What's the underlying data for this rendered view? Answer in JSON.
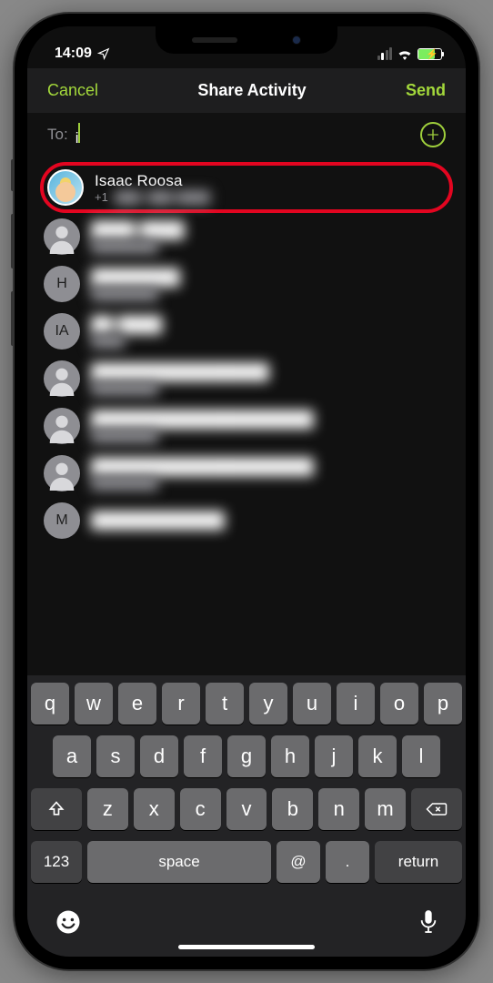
{
  "status": {
    "time": "14:09",
    "location_glyph": "✈"
  },
  "nav": {
    "cancel": "Cancel",
    "title": "Share Activity",
    "send": "Send"
  },
  "to": {
    "label": "To:",
    "value": "i"
  },
  "contacts": [
    {
      "name": "Isaac Roosa",
      "sub": "+1",
      "highlighted": true,
      "avatar_type": "memoji",
      "initial": ""
    },
    {
      "name": "████ ████",
      "sub": "████████",
      "avatar_type": "person",
      "initial": ""
    },
    {
      "name": "████████",
      "sub": "████████",
      "avatar_type": "initial",
      "initial": "H"
    },
    {
      "name": "██ ████",
      "sub": "████",
      "avatar_type": "initial",
      "initial": "IA"
    },
    {
      "name": "████████████████",
      "sub": "████████",
      "avatar_type": "person",
      "initial": ""
    },
    {
      "name": "████████████████████",
      "sub": "████████",
      "avatar_type": "person",
      "initial": ""
    },
    {
      "name": "████████████████████",
      "sub": "████████",
      "avatar_type": "person",
      "initial": ""
    },
    {
      "name": "████████████",
      "sub": "",
      "avatar_type": "initial",
      "initial": "M"
    }
  ],
  "keyboard": {
    "row1": [
      "q",
      "w",
      "e",
      "r",
      "t",
      "y",
      "u",
      "i",
      "o",
      "p"
    ],
    "row2": [
      "a",
      "s",
      "d",
      "f",
      "g",
      "h",
      "j",
      "k",
      "l"
    ],
    "row3": [
      "z",
      "x",
      "c",
      "v",
      "b",
      "n",
      "m"
    ],
    "key123": "123",
    "space": "space",
    "at": "@",
    "dot": ".",
    "ret": "return"
  }
}
